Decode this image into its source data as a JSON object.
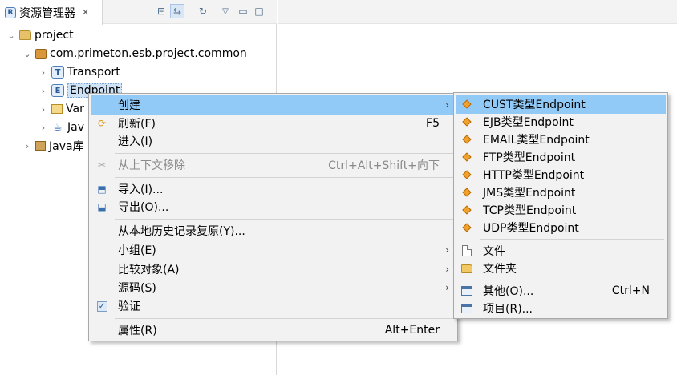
{
  "view": {
    "tab_title": "资源管理器",
    "tab_close": "✕",
    "toolbar": [
      "collapse-all",
      "link-with-editor",
      "sync",
      "view-menu",
      "minimize",
      "maximize"
    ]
  },
  "tree": {
    "project": "project",
    "common": "com.primeton.esb.project.common",
    "transport": "Transport",
    "endpoint": "Endpoint",
    "var": "Var",
    "java": "Jav",
    "javalib": "Java库"
  },
  "context_menu": {
    "create": "创建",
    "refresh": "刷新(F)",
    "refresh_acc": "F5",
    "goin": "进入(I)",
    "remove_context": "从上下文移除",
    "remove_context_acc": "Ctrl+Alt+Shift+向下",
    "import": "导入(I)...",
    "export": "导出(O)...",
    "restore_local": "从本地历史记录复原(Y)...",
    "team": "小组(E)",
    "compare": "比较对象(A)",
    "source": "源码(S)",
    "validate": "验证",
    "properties": "属性(R)",
    "properties_acc": "Alt+Enter"
  },
  "submenu": {
    "cust": "CUST类型Endpoint",
    "ejb": "EJB类型Endpoint",
    "email": "EMAIL类型Endpoint",
    "ftp": "FTP类型Endpoint",
    "http": "HTTP类型Endpoint",
    "jms": "JMS类型Endpoint",
    "tcp": "TCP类型Endpoint",
    "udp": "UDP类型Endpoint",
    "file": "文件",
    "folder": "文件夹",
    "other": "其他(O)...",
    "other_acc": "Ctrl+N",
    "project": "项目(R)..."
  },
  "colors": {
    "highlight": "#91c9f7",
    "menu_bg": "#f2f2f2",
    "endpoint_diamond": "#f0a22c"
  }
}
